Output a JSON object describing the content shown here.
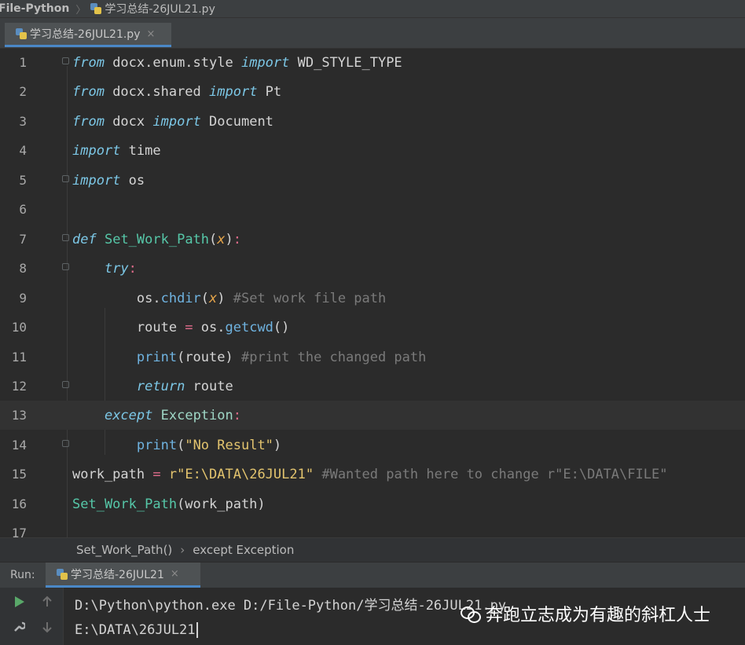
{
  "breadcrumb": {
    "project": "File-Python",
    "file": "学习总结-26JUL21.py"
  },
  "editor_tab": {
    "label": "学习总结-26JUL21.py",
    "close": "×"
  },
  "code": {
    "line_numbers": [
      "1",
      "2",
      "3",
      "4",
      "5",
      "6",
      "7",
      "8",
      "9",
      "10",
      "11",
      "12",
      "13",
      "14",
      "15",
      "16",
      "17"
    ],
    "current_line": "13"
  },
  "structure": {
    "function": "Set_Work_Path()",
    "separator": "›",
    "block": "except Exception"
  },
  "run": {
    "label": "Run:",
    "tab_label": "学习总结-26JUL21",
    "tab_close": "×",
    "output": [
      "D:\\Python\\python.exe D:/File-Python/学习总结-26JUL21.py",
      "E:\\DATA\\26JUL21"
    ]
  },
  "watermark": "奔跑立志成为有趣的斜杠人士",
  "colors": {
    "keyword": "#7cc7e6",
    "function": "#56c7a8",
    "operator": "#e06c8b",
    "string": "#e3c46e",
    "comment": "#7a7a7a",
    "accent": "#4a88c7"
  }
}
